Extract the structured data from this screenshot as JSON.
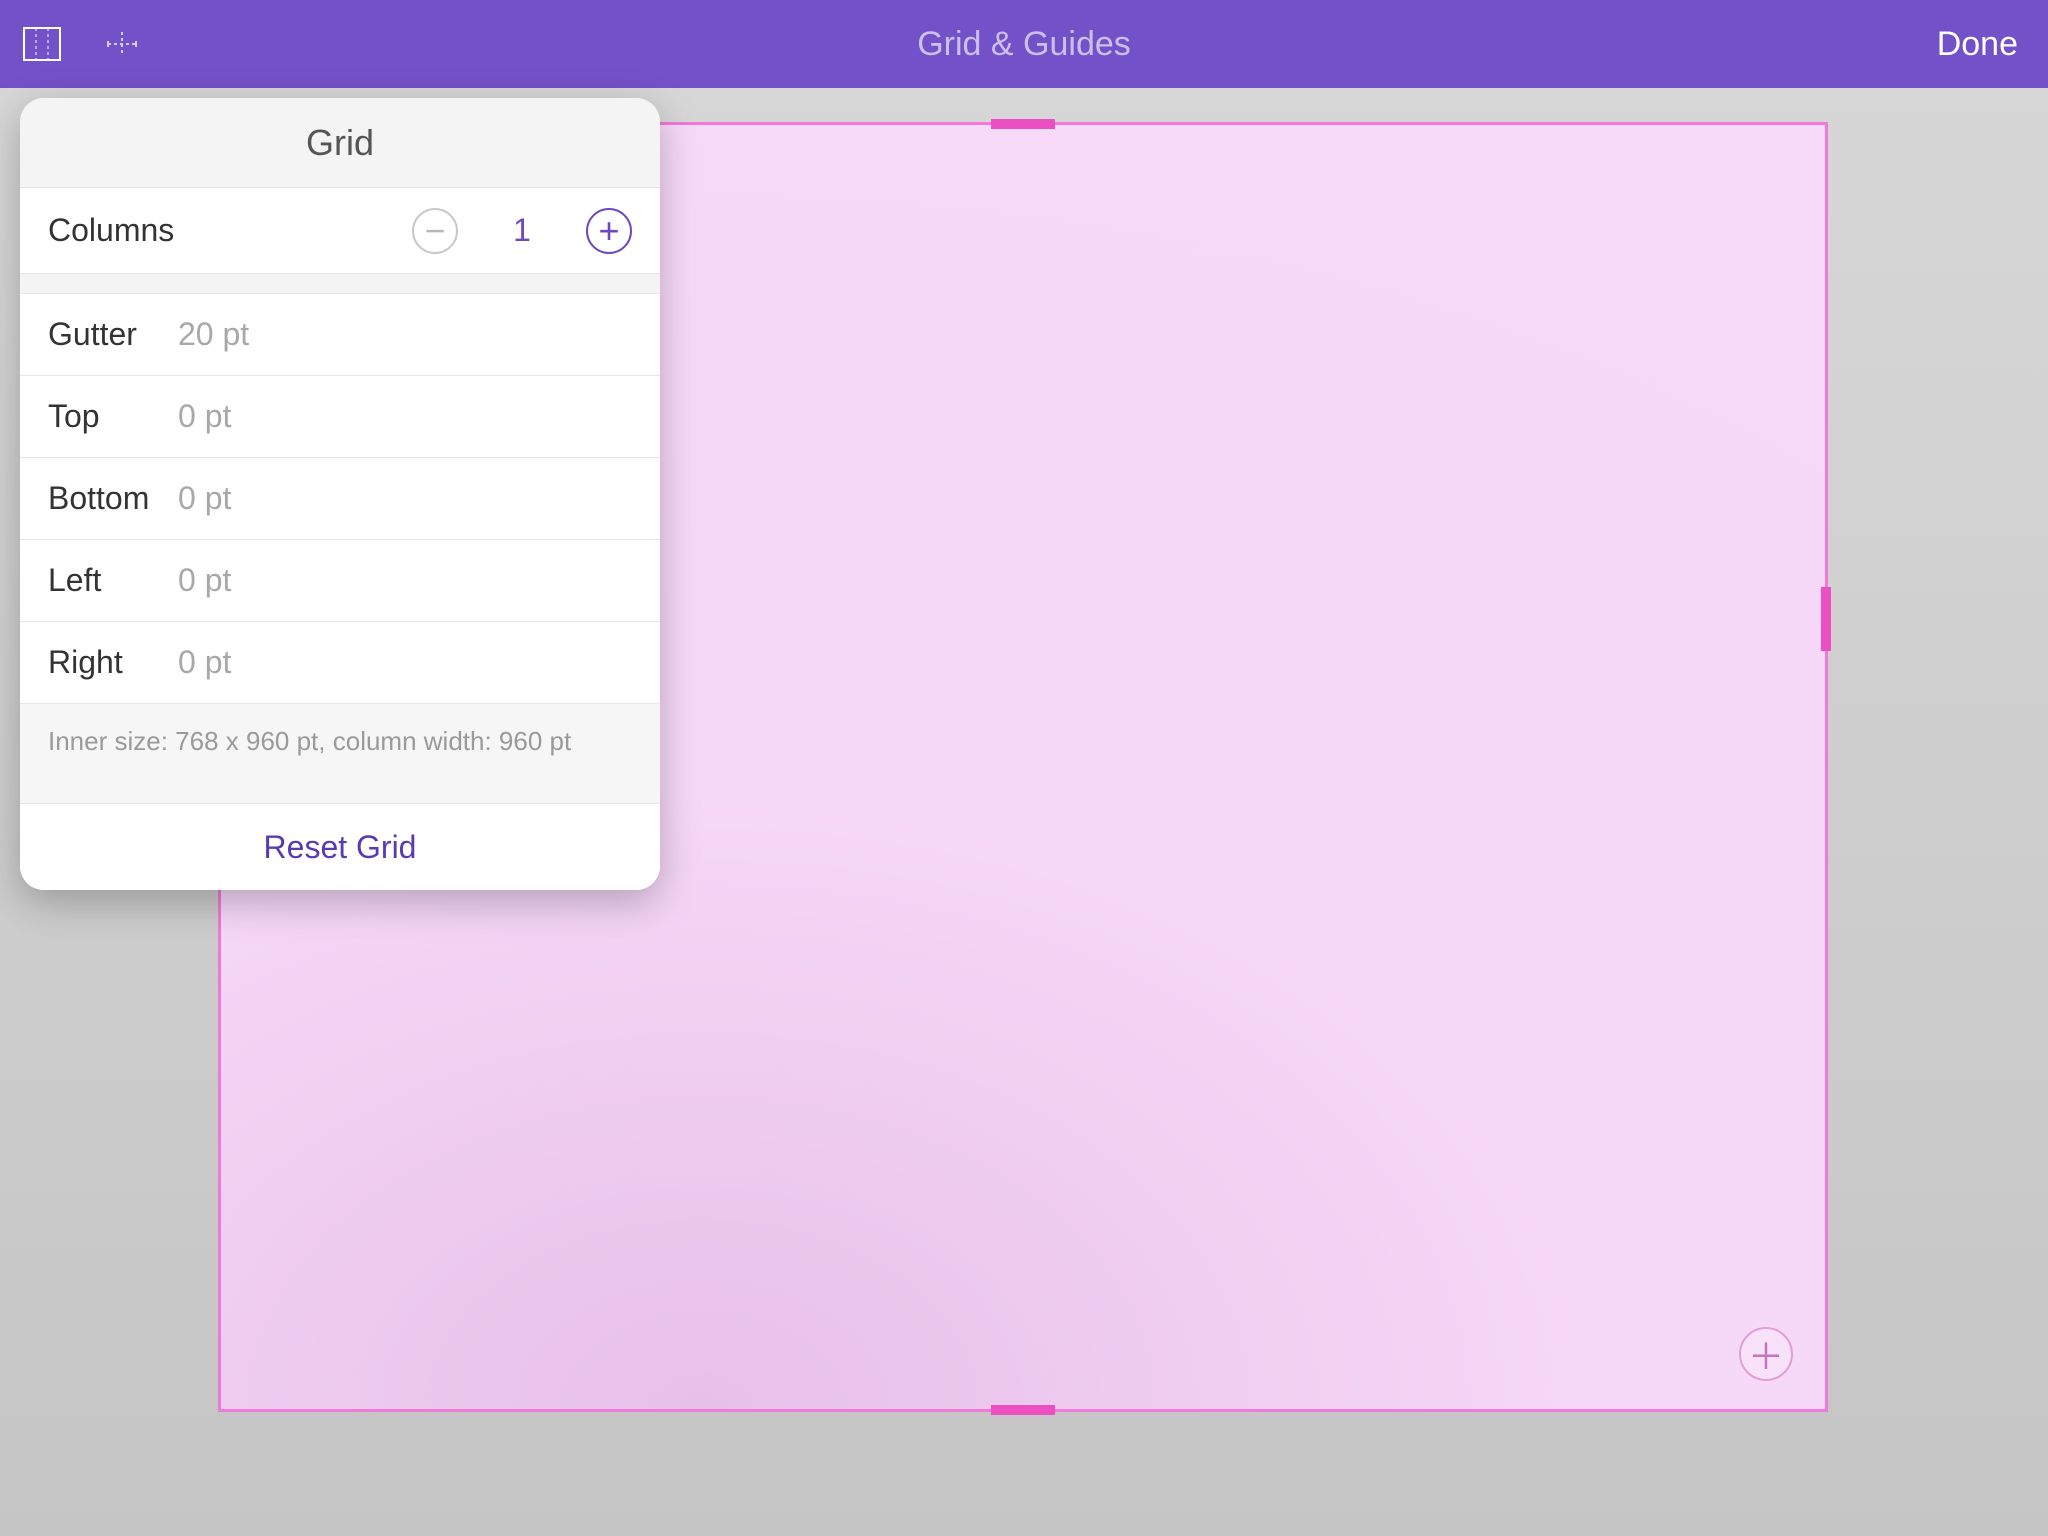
{
  "toolbar": {
    "title": "Grid & Guides",
    "done": "Done"
  },
  "popover": {
    "title": "Grid",
    "columns": {
      "label": "Columns",
      "value": "1"
    },
    "gutter": {
      "label": "Gutter",
      "value": "20 pt"
    },
    "top": {
      "label": "Top",
      "value": "0 pt"
    },
    "bottom": {
      "label": "Bottom",
      "value": "0 pt"
    },
    "left": {
      "label": "Left",
      "value": "0 pt"
    },
    "right": {
      "label": "Right",
      "value": "0 pt"
    },
    "info": "Inner size: 768 x 960 pt, column width: 960 pt",
    "reset": "Reset Grid"
  }
}
